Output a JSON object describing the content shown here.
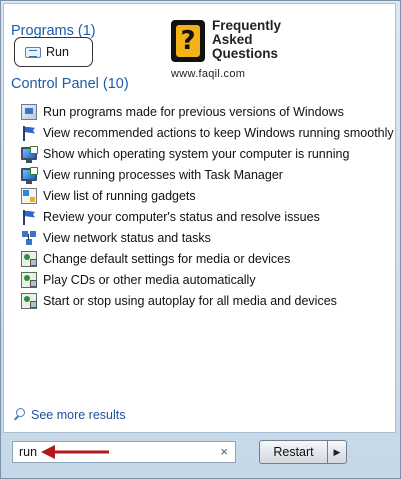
{
  "programs": {
    "title": "Programs (1)",
    "items": [
      {
        "label": "Run",
        "icon": "run-icon"
      }
    ]
  },
  "logo": {
    "line1": "Frequently",
    "line2": "Asked",
    "line3": "Questions",
    "url": "www.faqil.com",
    "mark": "?"
  },
  "control_panel": {
    "title": "Control Panel (10)",
    "items": [
      {
        "label": "Run programs made for previous versions of Windows",
        "icon": "compatibility-icon"
      },
      {
        "label": "View recommended actions to keep Windows running smoothly",
        "icon": "action-center-flag-icon"
      },
      {
        "label": "Show which operating system your computer is running",
        "icon": "system-monitor-icon"
      },
      {
        "label": "View running processes with Task Manager",
        "icon": "system-monitor-icon"
      },
      {
        "label": "View list of running gadgets",
        "icon": "gadgets-icon"
      },
      {
        "label": "Review your computer's status and resolve issues",
        "icon": "action-center-flag-icon"
      },
      {
        "label": "View network status and tasks",
        "icon": "network-icon"
      },
      {
        "label": "Change default settings for media or devices",
        "icon": "autoplay-icon"
      },
      {
        "label": "Play CDs or other media automatically",
        "icon": "autoplay-icon"
      },
      {
        "label": "Start or stop using autoplay for all media and devices",
        "icon": "autoplay-icon"
      }
    ]
  },
  "see_more": {
    "label": "See more results",
    "icon": "search-icon"
  },
  "search": {
    "value": "run",
    "clear_glyph": "×"
  },
  "shutdown": {
    "label": "Restart",
    "arrow_glyph": "▶"
  },
  "colors": {
    "section_title": "#1e5ba8",
    "annotation_arrow": "#b2181b"
  }
}
